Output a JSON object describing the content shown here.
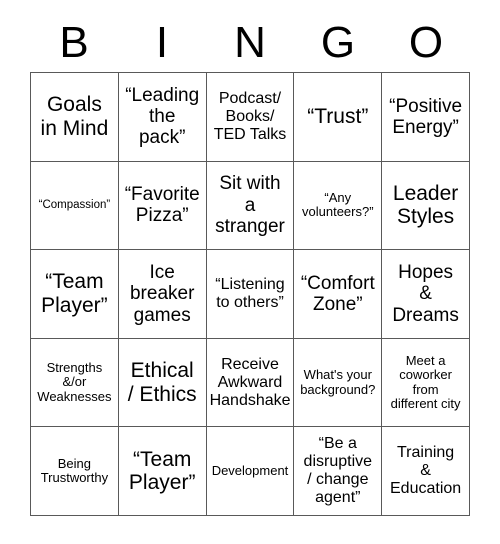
{
  "header": {
    "letters": [
      "B",
      "I",
      "N",
      "G",
      "O"
    ]
  },
  "colors": {
    "grid_line": "#595959",
    "text": "#000000",
    "background": "#ffffff"
  },
  "grid": {
    "columns": 5,
    "rows": 5,
    "cells": [
      {
        "text": "Goals\nin Mind",
        "size": "s-xl"
      },
      {
        "text": "“Leading\nthe\npack”",
        "size": "s-lg"
      },
      {
        "text": "Podcast/\nBooks/\nTED Talks",
        "size": "s-md"
      },
      {
        "text": "“Trust”",
        "size": "s-xl"
      },
      {
        "text": "“Positive\nEnergy”",
        "size": "s-lg"
      },
      {
        "text": "“Compassion”",
        "size": "s-xs"
      },
      {
        "text": "“Favorite\nPizza”",
        "size": "s-lg"
      },
      {
        "text": "Sit with\na\nstranger",
        "size": "s-lg"
      },
      {
        "text": "“Any\nvolunteers?”",
        "size": "s-sm"
      },
      {
        "text": "Leader\nStyles",
        "size": "s-xl"
      },
      {
        "text": "“Team\nPlayer”",
        "size": "s-xl"
      },
      {
        "text": "Ice\nbreaker\ngames",
        "size": "s-lg"
      },
      {
        "text": "“Listening\nto others”",
        "size": "s-md"
      },
      {
        "text": "“Comfort\nZone”",
        "size": "s-lg"
      },
      {
        "text": "Hopes\n&\nDreams",
        "size": "s-lg"
      },
      {
        "text": "Strengths\n&/or\nWeaknesses",
        "size": "s-sm"
      },
      {
        "text": "Ethical\n/ Ethics",
        "size": "s-xl"
      },
      {
        "text": "Receive\nAwkward\nHandshake",
        "size": "s-md"
      },
      {
        "text": "What's your\nbackground?",
        "size": "s-sm"
      },
      {
        "text": "Meet a\ncoworker\nfrom\ndifferent city",
        "size": "s-sm"
      },
      {
        "text": "Being\nTrustworthy",
        "size": "s-sm"
      },
      {
        "text": "“Team\nPlayer”",
        "size": "s-xl"
      },
      {
        "text": "Development",
        "size": "s-sm"
      },
      {
        "text": "“Be a\ndisruptive\n/ change\nagent”",
        "size": "s-md"
      },
      {
        "text": "Training\n&\nEducation",
        "size": "s-md"
      }
    ]
  }
}
